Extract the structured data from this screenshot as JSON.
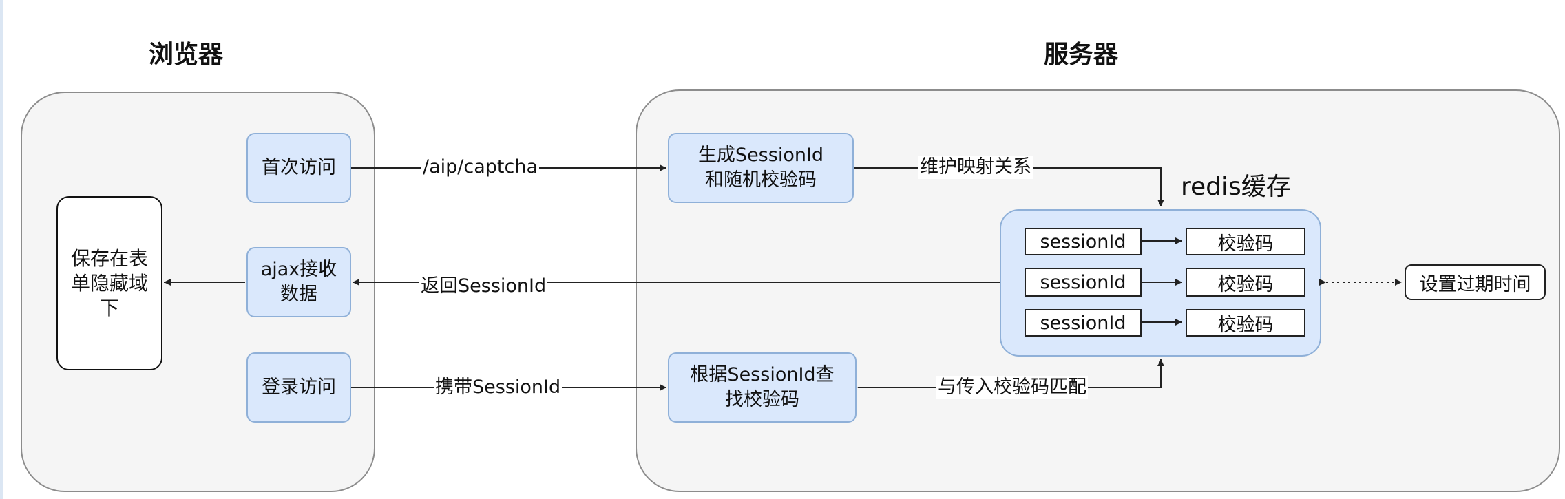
{
  "titles": {
    "browser": "浏览器",
    "server": "服务器"
  },
  "browser": {
    "first_visit": "首次访问",
    "ajax_receive": "ajax接收\n数据",
    "login_visit": "登录访问",
    "save_hidden": "保存在表\n单隐藏域\n下"
  },
  "server": {
    "generate": "生成SessionId\n和随机校验码",
    "lookup": "根据SessionId查\n找校验码"
  },
  "redis": {
    "title": "redis缓存",
    "rows": [
      {
        "key": "sessionId",
        "value": "校验码"
      },
      {
        "key": "sessionId",
        "value": "校验码"
      },
      {
        "key": "sessionId",
        "value": "校验码"
      }
    ],
    "expire": "设置过期时间"
  },
  "edges": {
    "captcha": "/aip/captcha",
    "return_session": "返回SessionId",
    "carry_session": "携带SessionId",
    "maintain_mapping": "维护映射关系",
    "match_code": "与传入校验码匹配"
  },
  "colors": {
    "node_fill": "#dae8fc",
    "node_stroke": "#8fb0d8",
    "panel_fill": "#f5f5f5",
    "panel_stroke": "#8c8c8c"
  }
}
